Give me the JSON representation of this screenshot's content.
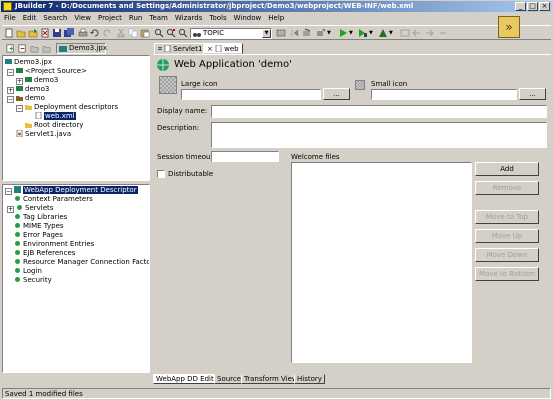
{
  "window": {
    "title": "JBuilder 7 - D:/Documents and Settings/Administrator/jbproject/Demo3/webproject/WEB-INF/web.xml"
  },
  "menu": [
    "File",
    "Edit",
    "Search",
    "View",
    "Project",
    "Run",
    "Team",
    "Wizards",
    "Tools",
    "Window",
    "Help"
  ],
  "toolbar": {
    "combo_value": "TOPIC"
  },
  "project_tab": {
    "label": "Demo3.jpx"
  },
  "project_tree": [
    {
      "label": "Demo3.jpx",
      "icon": "project-icon"
    },
    {
      "label": "<Project Source>",
      "icon": "package-icon"
    },
    {
      "label": "demo3",
      "icon": "package-icon"
    },
    {
      "label": "demo3",
      "icon": "package-icon"
    },
    {
      "label": "demo",
      "icon": "folder-icon"
    },
    {
      "label": "Deployment descriptors",
      "icon": "folder-icon"
    },
    {
      "label": "web.xml",
      "icon": "xml-file-icon",
      "selected": true
    },
    {
      "label": "Root directory",
      "icon": "folder-icon"
    },
    {
      "label": "Servlet1.java",
      "icon": "java-file-icon"
    }
  ],
  "structure_tree": [
    {
      "label": "WebApp Deployment Descriptor",
      "selected": true
    },
    {
      "label": "Context Parameters"
    },
    {
      "label": "Servlets"
    },
    {
      "label": "Tag Libraries"
    },
    {
      "label": "MIME Types"
    },
    {
      "label": "Error Pages"
    },
    {
      "label": "Environment Entries"
    },
    {
      "label": "EJB References"
    },
    {
      "label": "Resource Manager Connection Factory R"
    },
    {
      "label": "Login"
    },
    {
      "label": "Security"
    }
  ],
  "editor_tabs": [
    {
      "label": "Servlet1"
    },
    {
      "label": "web",
      "active": true
    }
  ],
  "editor": {
    "heading": "Web Application 'demo'",
    "large_icon_label": "Large icon",
    "small_icon_label": "Small icon",
    "browse_label": "...",
    "display_name_label": "Display name:",
    "description_label": "Description:",
    "session_timeout_label": "Session timeout",
    "welcome_files_label": "Welcome files",
    "distributable_label": "Distributable",
    "buttons": {
      "add": "Add",
      "remove": "Remove",
      "move_to_top": "Move to Top",
      "move_up": "Move Up",
      "move_down": "Move Down",
      "move_to_bottom": "Move to Bottom"
    }
  },
  "bottom_tabs": [
    {
      "label": "WebApp DD Editor",
      "active": true
    },
    {
      "label": "Source"
    },
    {
      "label": "Transform View"
    },
    {
      "label": "History"
    }
  ],
  "status": {
    "text": "Saved 1 modified files"
  }
}
